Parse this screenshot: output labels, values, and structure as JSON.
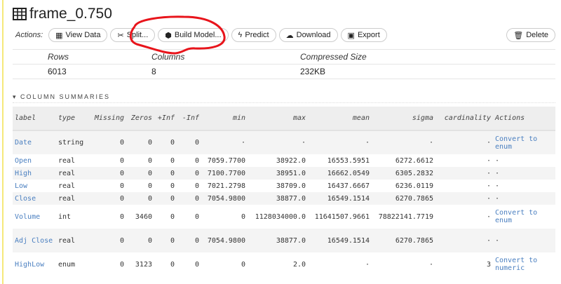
{
  "title": "frame_0.750",
  "actions": {
    "label": "Actions:",
    "buttons": [
      {
        "label": "View Data",
        "icon": "grid-icon"
      },
      {
        "label": "Split...",
        "icon": "scissors-icon"
      },
      {
        "label": "Build Model...",
        "icon": "cube-icon"
      },
      {
        "label": "Predict",
        "icon": "bolt-icon"
      },
      {
        "label": "Download",
        "icon": "cloud-download-icon"
      },
      {
        "label": "Export",
        "icon": "save-icon"
      }
    ],
    "delete": "Delete"
  },
  "summary": {
    "headers": [
      "Rows",
      "Columns",
      "Compressed Size"
    ],
    "values": [
      "6013",
      "8",
      "232KB"
    ]
  },
  "section_title": "COLUMN SUMMARIES",
  "table": {
    "headers": [
      "label",
      "type",
      "Missing",
      "Zeros",
      "+Inf",
      "-Inf",
      "min",
      "max",
      "mean",
      "sigma",
      "cardinality",
      "Actions"
    ],
    "rows": [
      [
        "Date",
        "string",
        "0",
        "0",
        "0",
        "0",
        "·",
        "·",
        "·",
        "·",
        "·",
        "Convert to enum"
      ],
      [
        "Open",
        "real",
        "0",
        "0",
        "0",
        "0",
        "7059.7700",
        "38922.0",
        "16553.5951",
        "6272.6612",
        "·",
        "·"
      ],
      [
        "High",
        "real",
        "0",
        "0",
        "0",
        "0",
        "7100.7700",
        "38951.0",
        "16662.0549",
        "6305.2832",
        "·",
        "·"
      ],
      [
        "Low",
        "real",
        "0",
        "0",
        "0",
        "0",
        "7021.2798",
        "38709.0",
        "16437.6667",
        "6236.0119",
        "·",
        "·"
      ],
      [
        "Close",
        "real",
        "0",
        "0",
        "0",
        "0",
        "7054.9800",
        "38877.0",
        "16549.1514",
        "6270.7865",
        "·",
        "·"
      ],
      [
        "Volume",
        "int",
        "0",
        "3460",
        "0",
        "0",
        "0",
        "1128034000.0",
        "11641507.9661",
        "78822141.7719",
        "·",
        "Convert to enum"
      ],
      [
        "Adj Close",
        "real",
        "0",
        "0",
        "0",
        "0",
        "7054.9800",
        "38877.0",
        "16549.1514",
        "6270.7865",
        "·",
        "·"
      ],
      [
        "HighLow",
        "enum",
        "0",
        "3123",
        "0",
        "0",
        "0",
        "2.0",
        "·",
        "·",
        "3",
        "Convert to numeric"
      ]
    ]
  },
  "annotation_color": "#e8141b"
}
